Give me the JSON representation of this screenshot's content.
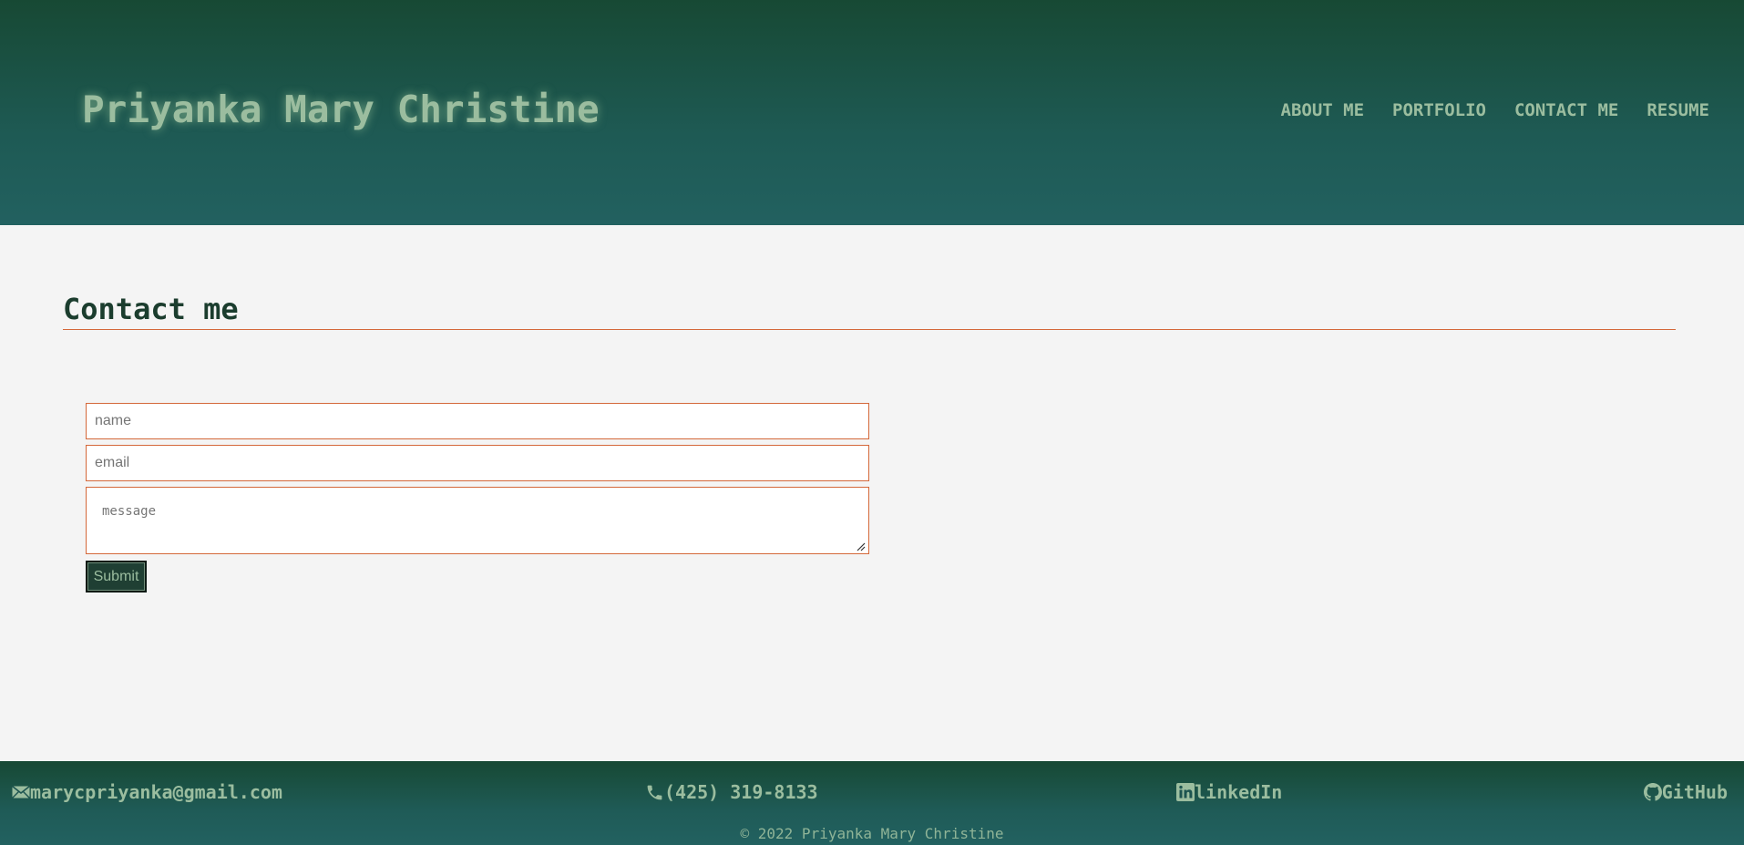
{
  "header": {
    "site_title": "Priyanka Mary Christine",
    "nav": [
      {
        "label": "ABOUT ME"
      },
      {
        "label": "PORTFOLIO"
      },
      {
        "label": "CONTACT ME"
      },
      {
        "label": "RESUME"
      }
    ]
  },
  "main": {
    "section_title": "Contact me",
    "form": {
      "name_placeholder": "name",
      "email_placeholder": "email",
      "message_placeholder": "message",
      "submit_label": "Submit"
    }
  },
  "footer": {
    "email": {
      "text": "marycpriyanka@gmail.com",
      "icon": "envelope-icon"
    },
    "phone": {
      "text": "(425) 319-8133",
      "icon": "phone-icon"
    },
    "linkedin": {
      "text": "linkedIn",
      "icon": "linkedin-icon"
    },
    "github": {
      "text": "GitHub",
      "icon": "github-icon"
    },
    "copyright": "© 2022 Priyanka Mary Christine"
  },
  "colors": {
    "header_dark": "#174934",
    "header_light": "#226160",
    "accent_text": "#9bbd9f",
    "input_border": "#d4683a",
    "heading_text": "#1b3d2e",
    "page_background": "#f4f4f4",
    "button_background": "#1f3f33"
  }
}
